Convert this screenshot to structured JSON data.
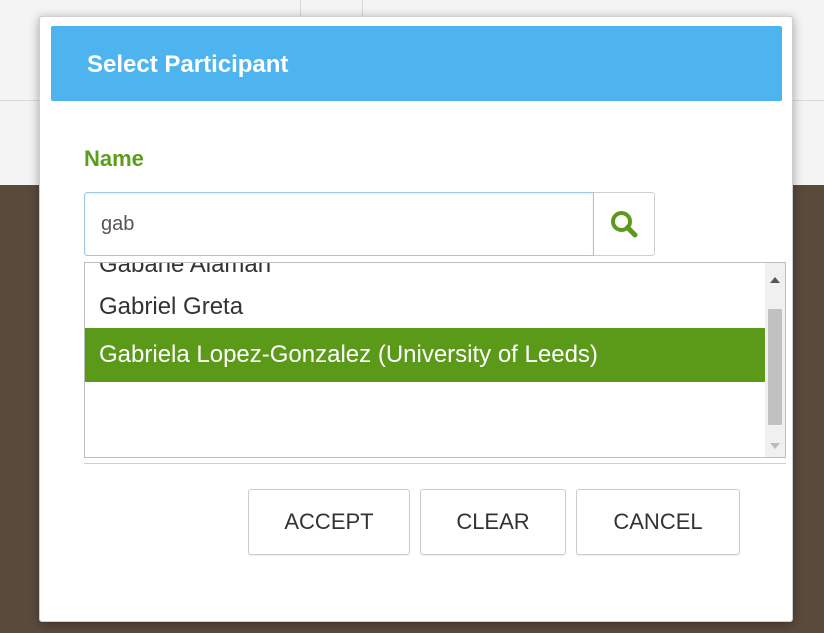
{
  "dialog": {
    "title": "Select Participant",
    "header_color": "#4db4f0"
  },
  "form": {
    "name_label": "Name",
    "search_value": "gab",
    "search_icon": "magnifier-icon",
    "label_color": "#5a9e1c"
  },
  "results": {
    "items": [
      {
        "label": "Gabarie Alaman",
        "selected": false
      },
      {
        "label": "Gabriel Greta",
        "selected": false
      },
      {
        "label": "Gabriela Lopez-Gonzalez (University of Leeds)",
        "selected": true
      }
    ],
    "selected_color": "#5b9a18"
  },
  "buttons": {
    "accept": "ACCEPT",
    "clear": "CLEAR",
    "cancel": "CANCEL"
  }
}
